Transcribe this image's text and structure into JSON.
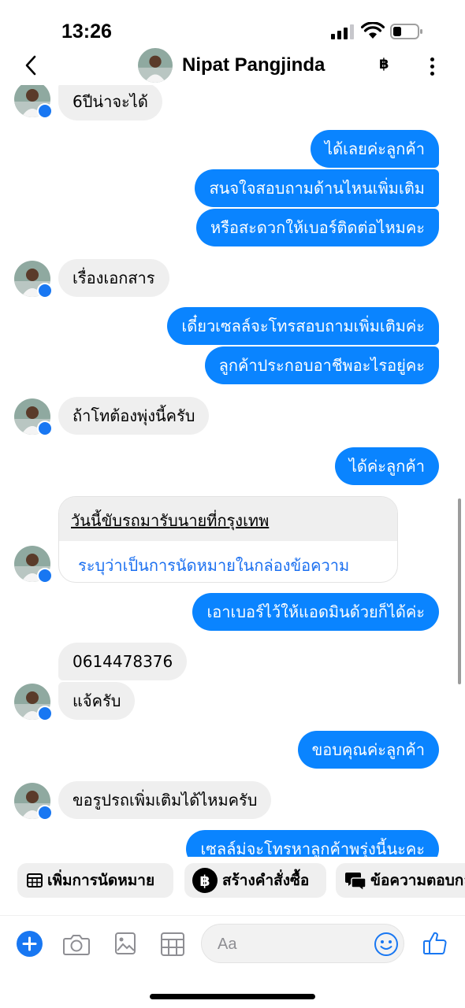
{
  "status_bar": {
    "time": "13:26"
  },
  "header": {
    "contact_name": "Nipat Pangjinda",
    "baht_symbol": "฿"
  },
  "messages": [
    {
      "side": "in",
      "text": "6ปีน่าจะได้"
    },
    {
      "side": "out",
      "text": "ได้เลยค่ะลูกค้า"
    },
    {
      "side": "out",
      "text": "สนจใจสอบถามด้านไหนเพิ่มเติม"
    },
    {
      "side": "out",
      "text": "หรือสะดวกให้เบอร์ติดต่อไหมคะ"
    },
    {
      "side": "in",
      "text": "เรื่องเอกสาร"
    },
    {
      "side": "out",
      "text": "เดี๋ยวเซลล์จะโทรสอบถามเพิ่มเติมค่ะ"
    },
    {
      "side": "out",
      "text": "ลูกค้าประกอบอาชีพอะไรอยู่คะ"
    },
    {
      "side": "in",
      "text": "ถ้าโทต้องพุ่งนี้ครับ"
    },
    {
      "side": "out",
      "text": "ได้ค่ะลูกค้า"
    },
    {
      "side": "out",
      "text": "เอาเบอร์ไว้ให้แอดมินด้วยก็ได้ค่ะ"
    },
    {
      "side": "in",
      "text": "0614478376"
    },
    {
      "side": "in",
      "text": "แจ้ครับ"
    },
    {
      "side": "out",
      "text": "ขอบคุณค่ะลูกค้า"
    },
    {
      "side": "in",
      "text": "ขอรูปรถเพิ่มเติมได้ไหมครับ"
    },
    {
      "side": "out",
      "text": "เซลล์ม่จะโทรหาลูกค้าพรุ่งนี้นะคะ"
    }
  ],
  "appointment_card": {
    "title": "วันนี้ขับรถมารับนายที่กรุงเทพ",
    "link": "ระบุว่าเป็นการนัดหมายในกล่องข้อความ"
  },
  "quick_actions": [
    {
      "label": "เพิ่มการนัดหมาย",
      "icon": "calendar-grid-icon"
    },
    {
      "label": "สร้างคำสั่งซื้อ",
      "icon": "baht-icon"
    },
    {
      "label": "ข้อความตอบกลับ",
      "icon": "chat-bubbles-icon"
    }
  ],
  "composer": {
    "placeholder": "Aa"
  },
  "colors": {
    "outgoing": "#0a84ff",
    "incoming": "#efefef",
    "accent": "#1877f2"
  }
}
